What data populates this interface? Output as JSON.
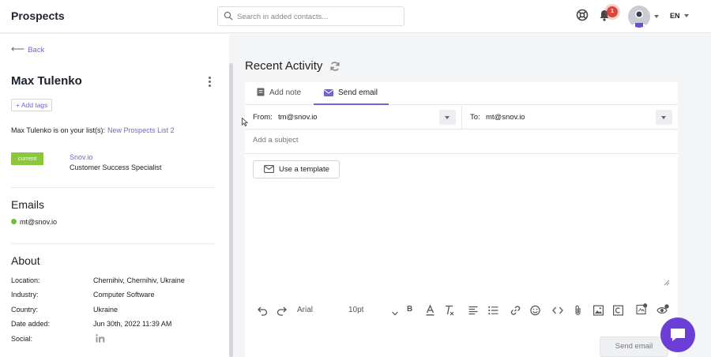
{
  "header": {
    "title": "Prospects",
    "search_placeholder": "Search in added contacts...",
    "language": "EN",
    "notifications_count": "1"
  },
  "contact": {
    "back_label": "Back",
    "name": "Max Tulenko",
    "add_tags_label": "+ Add tags",
    "list_text": "Max Tulenko is on your list(s):",
    "list_name": "New Prospects List 2",
    "job_badge": "current",
    "company": "Snov.io",
    "role": "Customer Success Specialist"
  },
  "emails": {
    "heading": "Emails",
    "items": [
      "mt@snov.io"
    ]
  },
  "about": {
    "heading": "About",
    "rows": [
      {
        "label": "Location:",
        "value": "Chernihiv, Chernihiv, Ukraine"
      },
      {
        "label": "Industry:",
        "value": "Computer Software"
      },
      {
        "label": "Country:",
        "value": "Ukraine"
      },
      {
        "label": "Date added:",
        "value": "Jun 30th, 2022 11:39 AM"
      },
      {
        "label": "Social:",
        "value": ""
      }
    ]
  },
  "activity": {
    "title": "Recent Activity",
    "tabs": [
      {
        "label": "Add note"
      },
      {
        "label": "Send email"
      }
    ],
    "active_tab": "Send email",
    "from_label": "From:",
    "from_value": "tm@snov.io",
    "to_label": "To:",
    "to_value": "mt@snov.io",
    "subject_placeholder": "Add a subject",
    "template_button": "Use a template",
    "font_name": "Arial",
    "font_size": "10pt",
    "send_button": "Send email"
  },
  "colors": {
    "accent": "#7a5fd4",
    "badge_green": "#8cc63f",
    "chat": "#6b3fd6"
  }
}
